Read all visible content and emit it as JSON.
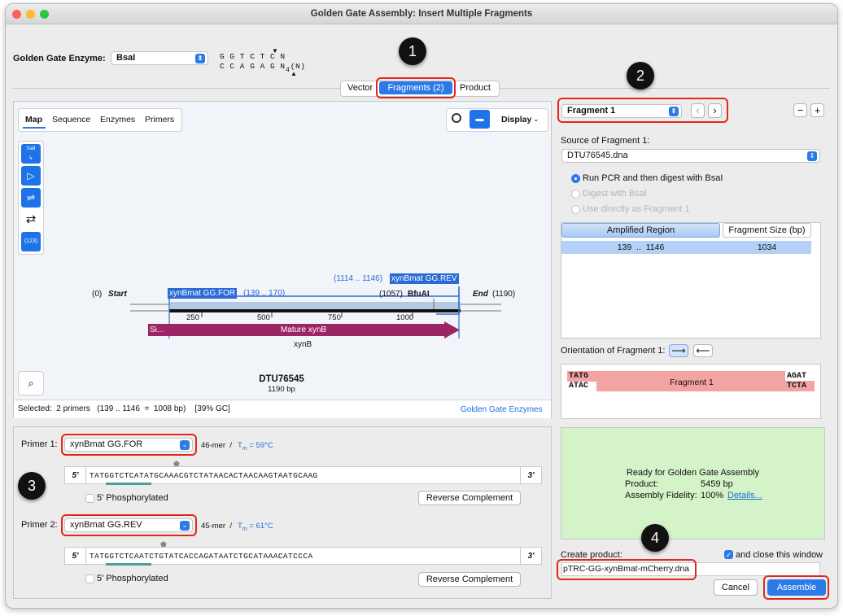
{
  "window": {
    "title": "Golden Gate Assembly: Insert Multiple Fragments"
  },
  "enzyme": {
    "label": "Golden Gate Enzyme:",
    "value": "BsaI",
    "site_top": "G G T C T C N",
    "site_bottom": "C C A G A G N (N)",
    "site_sub": "4"
  },
  "tabs": {
    "vector": "Vector",
    "fragments": "Fragments (2)",
    "product": "Product"
  },
  "badges": [
    "1",
    "2",
    "3",
    "4"
  ],
  "map": {
    "view_tabs": [
      "Map",
      "Sequence",
      "Enzymes",
      "Primers"
    ],
    "display_label": "Display",
    "toolbar_icon_label": "SalI",
    "toolbar_icon_num": "(123)",
    "start_pos": "(0)",
    "start_label": "Start",
    "end_label": "End",
    "end_pos": "(1190)",
    "primer_for_label": "xynBmat GG.FOR",
    "primer_for_range": "(139 .. 170)",
    "primer_rev_range": "(1114 .. 1146)",
    "primer_rev_label": "xynBmat GG.REV",
    "bfuai_pos": "(1057)",
    "bfuai_label": "BfuAI",
    "ticks": [
      "250",
      "500",
      "750",
      "1000"
    ],
    "feature_small": "Si...",
    "feature_main": "Mature xynB",
    "gene_label": "xynB",
    "seq_name": "DTU76545",
    "seq_len": "1190 bp",
    "selection_text": "Selected:  2 primers   (139 .. 1146  =  1008 bp)    [39% GC]",
    "gg_link": "Golden Gate Enzymes"
  },
  "primers": {
    "p1_label": "Primer 1:",
    "p1_value": "xynBmat GG.FOR",
    "p1_len": "46-mer  /",
    "p1_tm_label": "T",
    "p1_tm_sub": "m",
    "p1_tm_value": " = 59°C",
    "p1_seq": "TATGGTCTCATATGCAAACGTCTATAACACTAACAAGTAATGCAAG",
    "p2_label": "Primer 2:",
    "p2_value": "xynBmat GG.REV",
    "p2_len": "45-mer  /",
    "p2_tm_label": "T",
    "p2_tm_sub": "m",
    "p2_tm_value": " = 61°C",
    "p2_seq": "TATGGTCTCAATCTGTATCACCAGATAATCTGCATAAACATCCCA",
    "five": "5'",
    "three": "3'",
    "phos_label": "5' Phosphorylated",
    "rc_label": "Reverse Complement"
  },
  "fragment": {
    "selector": "Fragment 1",
    "prev": "‹",
    "next": "›",
    "minus": "−",
    "plus": "+",
    "source_label": "Source of Fragment 1:",
    "source_value": "DTU76545.dna",
    "radio1": "Run PCR and then digest with BsaI",
    "radio2": "Digest with BsaI",
    "radio3": "Use directly as Fragment 1",
    "col_amplified": "Amplified Region",
    "col_size": "Fragment Size (bp)",
    "row_region": "139  ..  1146",
    "row_size": "1034",
    "orientation_label": "Orientation of Fragment 1:",
    "end_left_top": "TATG",
    "end_left_bottom": "ATAC",
    "end_right_top": "AGAT",
    "end_right_bottom": "TCTA",
    "fragment_name": "Fragment 1"
  },
  "status": {
    "ready": "Ready for Golden Gate Assembly",
    "product_label": "Product:",
    "product_value": "5459 bp",
    "fidelity_label": "Assembly Fidelity:",
    "fidelity_value": "100%",
    "details_link": "Details..."
  },
  "create": {
    "label": "Create product:",
    "close_label": "and close this window",
    "filename": "pTRC-GG-xynBmat-mCherry.dna",
    "cancel": "Cancel",
    "assemble": "Assemble"
  },
  "colors": {
    "accent": "#2b7ae8",
    "highlight": "#e0281b",
    "feature": "#9c2665",
    "status_bg": "#d5f3c8"
  }
}
